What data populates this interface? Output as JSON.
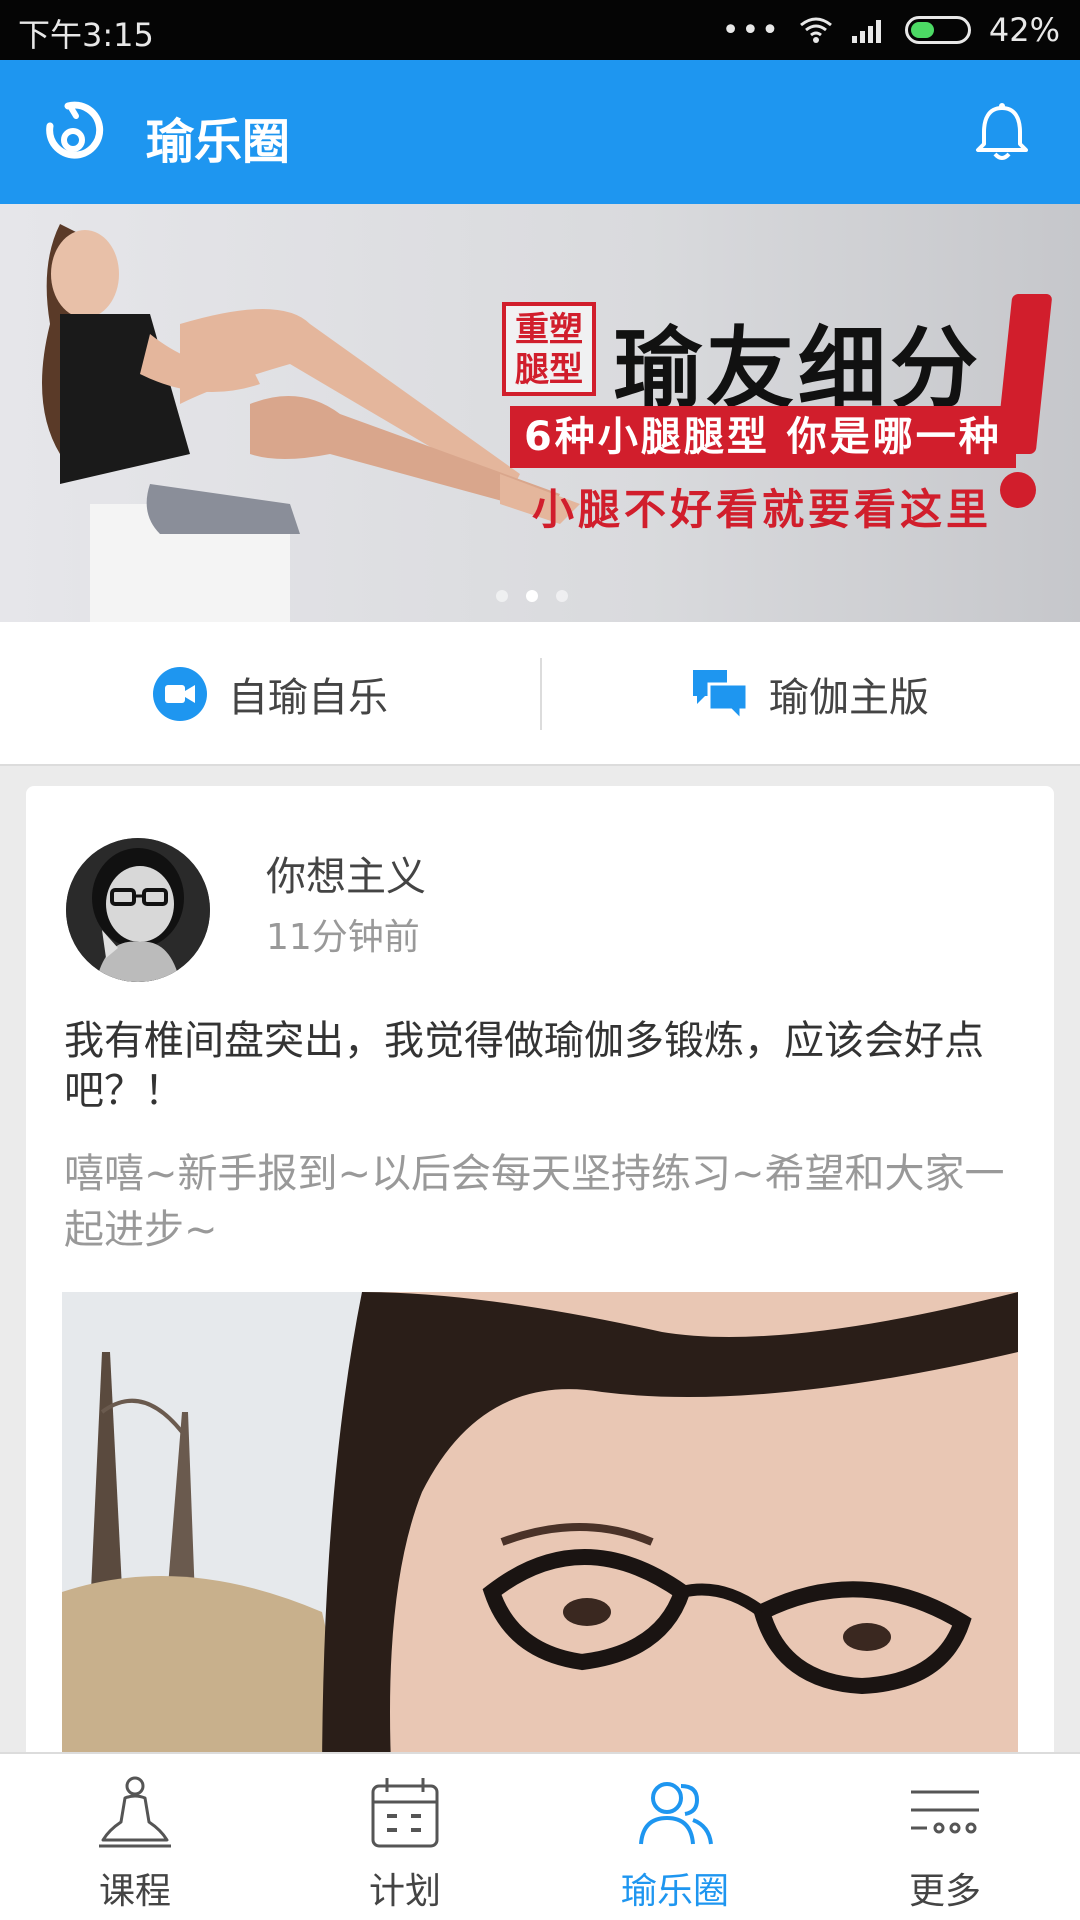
{
  "status_bar": {
    "time": "下午3:15",
    "battery_percent": "42%",
    "battery_level": 0.42,
    "battery_color": "#4cd964"
  },
  "app_bar": {
    "title": "瑜乐圈",
    "logo_icon": "yoga-logo-icon",
    "bell_icon": "bell-icon",
    "background": "#1e96f0"
  },
  "banner": {
    "tag": "重塑腿型",
    "headline": "瑜友细分",
    "subtitle_1": "6种小腿腿型 你是哪一种",
    "subtitle_2": "小腿不好看就要看这里",
    "slides": 3,
    "active_slide": 2
  },
  "tabs": [
    {
      "label": "自瑜自乐",
      "icon": "video-camera-icon"
    },
    {
      "label": "瑜伽主版",
      "icon": "chat-bubbles-icon"
    }
  ],
  "post": {
    "username": "你想主义",
    "time_ago": "11分钟前",
    "title": "我有椎间盘突出，我觉得做瑜伽多锻炼，应该会好点吧？！",
    "body": "嘻嘻~新手报到~以后会每天坚持练习~希望和大家一起进步~"
  },
  "bottom_nav": [
    {
      "label": "课程",
      "icon": "meditation-person-icon",
      "active": false
    },
    {
      "label": "计划",
      "icon": "calendar-icon",
      "active": false
    },
    {
      "label": "瑜乐圈",
      "icon": "people-icon",
      "active": true
    },
    {
      "label": "更多",
      "icon": "more-lines-icon",
      "active": false
    }
  ],
  "colors": {
    "accent": "#1e96f0",
    "banner_red": "#d11e2c"
  }
}
